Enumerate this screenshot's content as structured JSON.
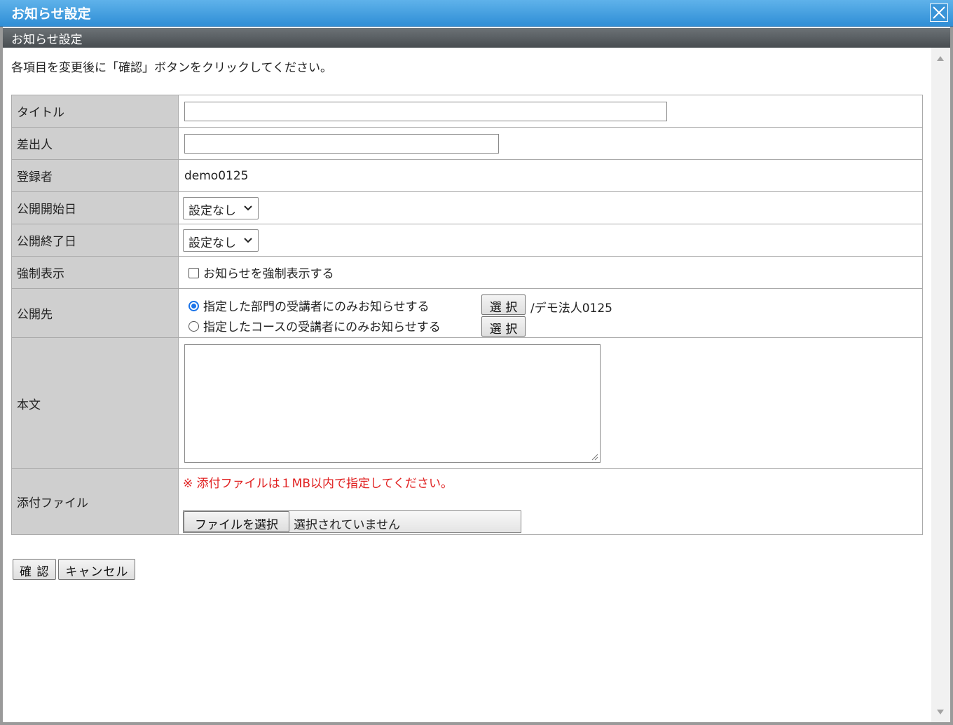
{
  "window": {
    "title": "お知らせ設定",
    "subtitle": "お知らせ設定"
  },
  "instruction": "各項目を変更後に「確認」ボタンをクリックしてください。",
  "form": {
    "title_label": "タイトル",
    "title_value": "",
    "sender_label": "差出人",
    "sender_value": "",
    "registrant_label": "登録者",
    "registrant_value": "demo0125",
    "start_label": "公開開始日",
    "start_value": "設定なし",
    "end_label": "公開終了日",
    "end_value": "設定なし",
    "force_label": "強制表示",
    "force_option": "お知らせを強制表示する",
    "force_checked": false,
    "target_label": "公開先",
    "target_option_dept": "指定した部門の受講者にのみお知らせする",
    "target_option_course": "指定したコースの受講者にのみお知らせする",
    "target_selected": "dept",
    "select_button": "選 択",
    "dept_path": "/デモ法人0125",
    "body_label": "本文",
    "body_value": "",
    "attach_label": "添付ファイル",
    "attach_note": "※ 添付ファイルは１MB以内で指定してください。",
    "file_button": "ファイルを選択",
    "file_status": "選択されていません"
  },
  "actions": {
    "confirm": "確 認",
    "cancel": "キャンセル"
  },
  "colors": {
    "titlebar": "#2f8ed6",
    "subbar": "#484d51",
    "label_bg": "#cfcfcf",
    "note": "#e02020",
    "radio": "#1a73e8"
  }
}
